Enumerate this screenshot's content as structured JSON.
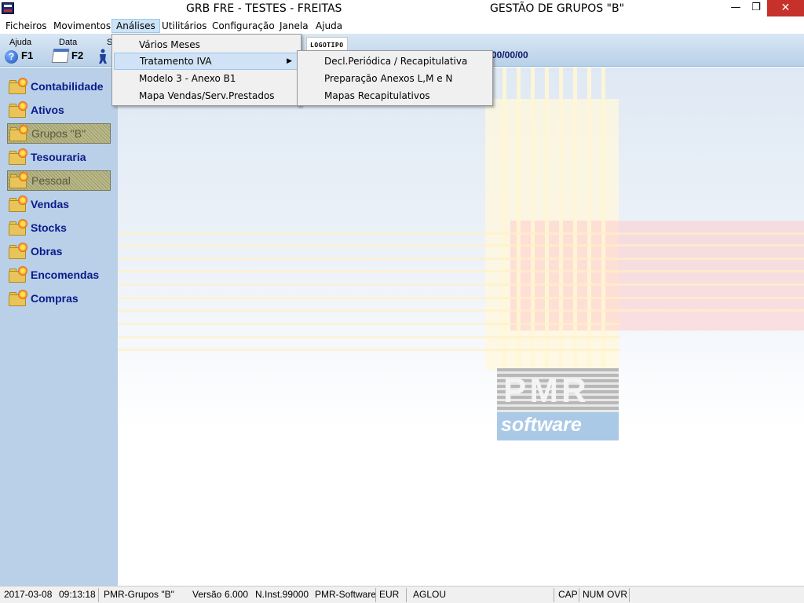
{
  "window": {
    "title_left": "GRB FRE - TESTES - FREITAS",
    "title_right": "GESTÃO DE GRUPOS \"B\"",
    "minimize": "—",
    "maximize": "❐",
    "close": "✕"
  },
  "menubar": [
    "Ficheiros",
    "Movimentos",
    "Análises",
    "Utilitários",
    "Configuração",
    "Janela",
    "Ajuda"
  ],
  "toolbar": {
    "help_caption": "Ajuda",
    "help_key": "F1",
    "date_caption": "Data",
    "date_key": "F2",
    "third_caption": "S",
    "logo_slot": "LOGOTIPO",
    "date_readout": "00/00/00"
  },
  "sidebar": [
    {
      "label": "Contabilidade",
      "enabled": true
    },
    {
      "label": "Ativos",
      "enabled": true
    },
    {
      "label": "Grupos \"B\"",
      "enabled": false
    },
    {
      "label": "Tesouraria",
      "enabled": true
    },
    {
      "label": "Pessoal",
      "enabled": false
    },
    {
      "label": "Vendas",
      "enabled": true
    },
    {
      "label": "Stocks",
      "enabled": true
    },
    {
      "label": "Obras",
      "enabled": true
    },
    {
      "label": "Encomendas",
      "enabled": true
    },
    {
      "label": "Compras",
      "enabled": true
    }
  ],
  "analises_menu": {
    "items": [
      "Vários Meses",
      "Tratamento IVA",
      "Modelo 3 - Anexo B1",
      "Mapa Vendas/Serv.Prestados"
    ],
    "highlighted": "Tratamento IVA"
  },
  "iva_submenu": {
    "items": [
      "Decl.Periódica / Recapitulativa",
      "Preparação Anexos L,M e N",
      "Mapas Recapitulativos"
    ]
  },
  "logo": {
    "letters": "PMR",
    "word": "software"
  },
  "statusbar": {
    "date": "2017-03-08",
    "time": "09:13:18",
    "module": "PMR-Grupos \"B\"",
    "version_label": "Versão",
    "version": "6.000",
    "install": "N.Inst.99000",
    "company": "PMR-Software",
    "currency": "EUR",
    "user": "AGLOU",
    "cap": "CAP",
    "num": "NUM",
    "ovr": "OVR"
  },
  "colors": {
    "sidebar_bg": "#b9d0e8",
    "sidebar_text": "#0a1a8a",
    "close_button": "#c7312b",
    "menu_highlight": "#cce4f7"
  }
}
